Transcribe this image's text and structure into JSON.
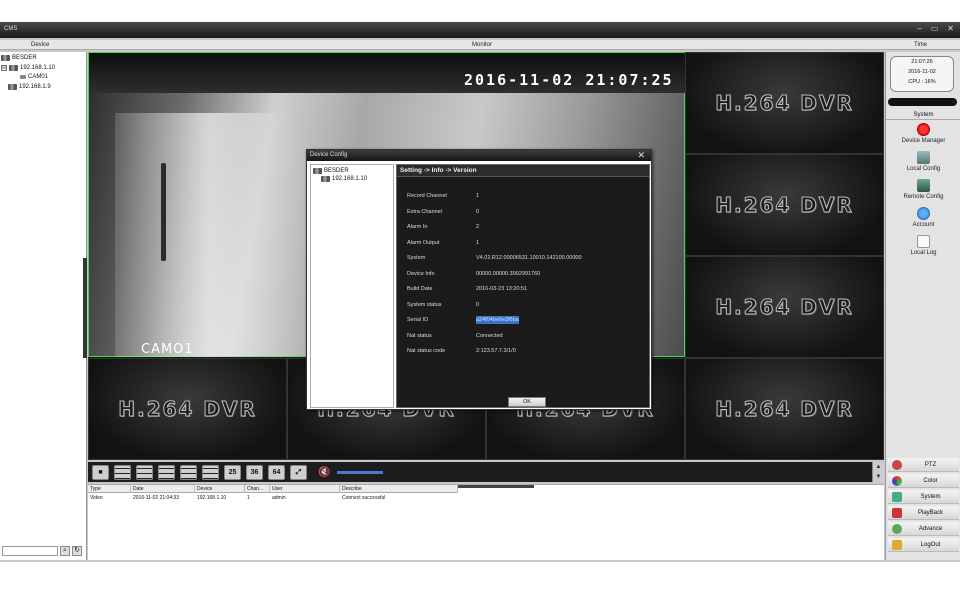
{
  "window": {
    "title": "CMS"
  },
  "columns": {
    "device": "Device",
    "monitor": "Monitor",
    "time": "Time"
  },
  "device_tree": {
    "root": "BESDER",
    "items": [
      {
        "label": "192.168.1.10",
        "expanded": "⊟"
      },
      {
        "label": "CAM01"
      },
      {
        "label": "192.168.1.9"
      }
    ]
  },
  "monitor": {
    "osd_time": "2016-11-02 21:07:25",
    "osd_camera": "CAMO1",
    "placeholder_label": "H.264 DVR"
  },
  "toolbar": {
    "layouts": [
      "25",
      "36",
      "64"
    ]
  },
  "log": {
    "headers": [
      "Type",
      "Date",
      "Device",
      "Chan...",
      "User",
      "Describe"
    ],
    "rows": [
      {
        "type": "Video",
        "date": "2016-11-02 21:04:33",
        "device": "192.168.1.10",
        "channel": "1",
        "user": "admin",
        "describe": "Connect successful"
      }
    ]
  },
  "right_panel": {
    "time": "21:07:26",
    "date": "2016-11-02",
    "cpu": "CPU : 16%",
    "system_heading": "System",
    "system_items": [
      "Device Manager",
      "Local Config",
      "Remote Config",
      "Account",
      "Local Log"
    ],
    "buttons": [
      "PTZ",
      "Color",
      "System",
      "PlayBack",
      "Advance",
      "LogOut"
    ]
  },
  "dialog": {
    "title": "Device Config",
    "tree_root": "BESDER",
    "tree_item": "192.168.1.10",
    "breadcrumb": "Setting -> Info -> Version",
    "fields": [
      {
        "label": "Record Channel",
        "value": "1"
      },
      {
        "label": "Extra Channel",
        "value": "0"
      },
      {
        "label": "Alarm In",
        "value": "2"
      },
      {
        "label": "Alarm Output",
        "value": "1"
      },
      {
        "label": "System",
        "value": "V4.02.R12.00006531.10010.142100.00000"
      },
      {
        "label": "Device Info",
        "value": "00000.00000.3992991760"
      },
      {
        "label": "Build Date",
        "value": "2016-03-23 13:20:51"
      },
      {
        "label": "System status",
        "value": "0"
      },
      {
        "label": "Serial ID",
        "value": "a24f04be6e3f6ba"
      },
      {
        "label": "Nat status",
        "value": "Connected"
      },
      {
        "label": "Nat status code",
        "value": "2:123.57.7.3/1/0"
      }
    ],
    "ok_label": "OK"
  },
  "colors": {
    "accent_blue": "#3b73c9",
    "active_border": "#3fdc3f"
  }
}
